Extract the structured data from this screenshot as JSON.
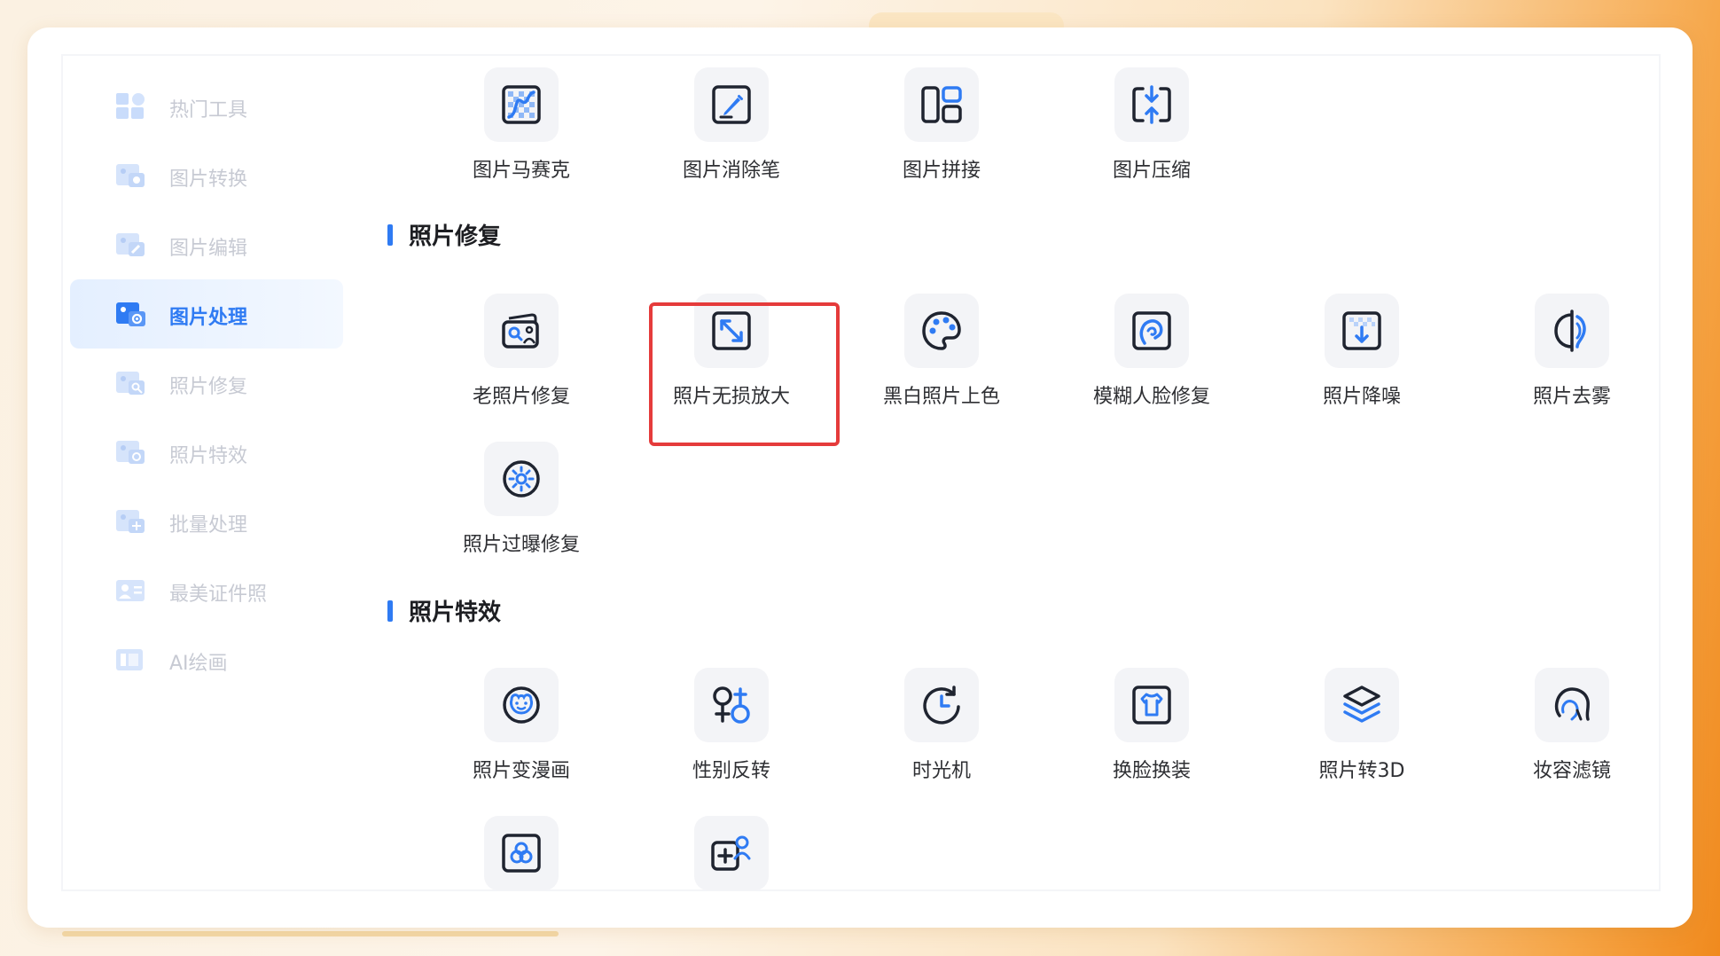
{
  "sidebar": {
    "items": [
      {
        "label": "热门工具",
        "icon": "hot-tools-icon"
      },
      {
        "label": "图片转换",
        "icon": "image-convert-icon"
      },
      {
        "label": "图片编辑",
        "icon": "image-edit-icon"
      },
      {
        "label": "图片处理",
        "icon": "image-process-icon",
        "active": true
      },
      {
        "label": "照片修复",
        "icon": "photo-repair-icon"
      },
      {
        "label": "照片特效",
        "icon": "photo-effect-icon"
      },
      {
        "label": "批量处理",
        "icon": "batch-process-icon"
      },
      {
        "label": "最美证件照",
        "icon": "id-photo-icon"
      },
      {
        "label": "AI绘画",
        "icon": "ai-paint-icon"
      }
    ]
  },
  "top_tools": [
    {
      "label": "图片马赛克",
      "icon": "mosaic-icon"
    },
    {
      "label": "图片消除笔",
      "icon": "eraser-pen-icon"
    },
    {
      "label": "图片拼接",
      "icon": "collage-icon"
    },
    {
      "label": "图片压缩",
      "icon": "compress-icon"
    }
  ],
  "sections": [
    {
      "title": "照片修复",
      "tools": [
        {
          "label": "老照片修复",
          "icon": "old-photo-icon"
        },
        {
          "label": "照片无损放大",
          "icon": "enlarge-icon",
          "highlighted": true
        },
        {
          "label": "黑白照片上色",
          "icon": "palette-icon"
        },
        {
          "label": "模糊人脸修复",
          "icon": "face-repair-icon"
        },
        {
          "label": "照片降噪",
          "icon": "denoise-icon"
        },
        {
          "label": "照片去雾",
          "icon": "dehaze-icon"
        },
        {
          "label": "照片过曝修复",
          "icon": "exposure-icon"
        }
      ]
    },
    {
      "title": "照片特效",
      "tools": [
        {
          "label": "照片变漫画",
          "icon": "cartoon-icon"
        },
        {
          "label": "性别反转",
          "icon": "gender-swap-icon"
        },
        {
          "label": "时光机",
          "icon": "time-machine-icon"
        },
        {
          "label": "换脸换装",
          "icon": "face-swap-icon"
        },
        {
          "label": "照片转3D",
          "icon": "layers-3d-icon"
        },
        {
          "label": "妆容滤镜",
          "icon": "makeup-filter-icon"
        },
        {
          "label": "",
          "icon": "portrait-frame-icon"
        },
        {
          "label": "",
          "icon": "add-person-icon"
        }
      ]
    }
  ],
  "colors": {
    "accent": "#2f7bf3",
    "icon_dark": "#1f2430",
    "highlight": "#e53b3b"
  }
}
